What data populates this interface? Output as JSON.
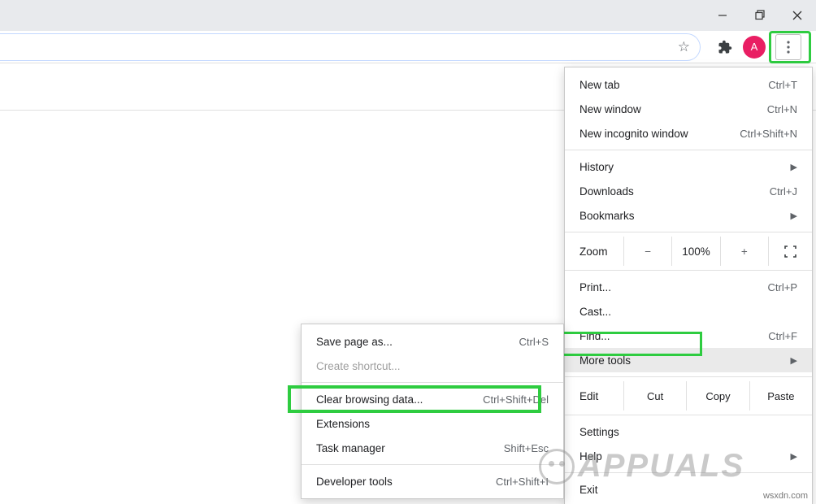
{
  "avatar_letter": "A",
  "menu": {
    "new_tab": {
      "label": "New tab",
      "shortcut": "Ctrl+T"
    },
    "new_window": {
      "label": "New window",
      "shortcut": "Ctrl+N"
    },
    "new_incognito": {
      "label": "New incognito window",
      "shortcut": "Ctrl+Shift+N"
    },
    "history": {
      "label": "History"
    },
    "downloads": {
      "label": "Downloads",
      "shortcut": "Ctrl+J"
    },
    "bookmarks": {
      "label": "Bookmarks"
    },
    "zoom_label": "Zoom",
    "zoom_value": "100%",
    "print": {
      "label": "Print...",
      "shortcut": "Ctrl+P"
    },
    "cast": {
      "label": "Cast..."
    },
    "find": {
      "label": "Find...",
      "shortcut": "Ctrl+F"
    },
    "more_tools": {
      "label": "More tools"
    },
    "edit_label": "Edit",
    "cut": "Cut",
    "copy": "Copy",
    "paste": "Paste",
    "settings": {
      "label": "Settings"
    },
    "help": {
      "label": "Help"
    },
    "exit": {
      "label": "Exit"
    }
  },
  "submenu": {
    "save_page": {
      "label": "Save page as...",
      "shortcut": "Ctrl+S"
    },
    "create_shortcut": {
      "label": "Create shortcut..."
    },
    "clear_data": {
      "label": "Clear browsing data...",
      "shortcut": "Ctrl+Shift+Del"
    },
    "extensions": {
      "label": "Extensions"
    },
    "task_manager": {
      "label": "Task manager",
      "shortcut": "Shift+Esc"
    },
    "dev_tools": {
      "label": "Developer tools",
      "shortcut": "Ctrl+Shift+I"
    }
  },
  "watermark": "APPUALS",
  "domain_text": "wsxdn.com"
}
